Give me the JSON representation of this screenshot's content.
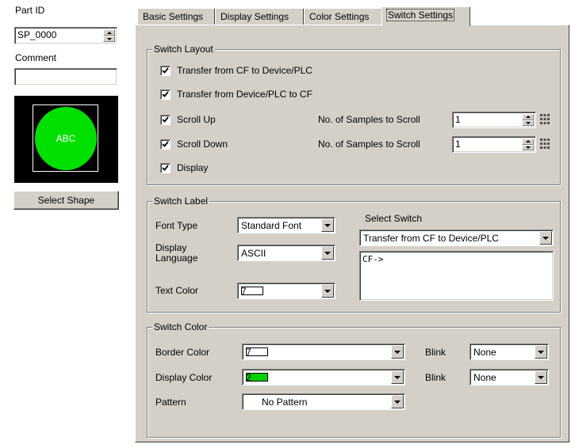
{
  "left": {
    "part_id_label": "Part ID",
    "part_id_value": "SP_0000",
    "comment_label": "Comment",
    "comment_value": "",
    "preview_text": "ABC",
    "select_shape_label": "Select Shape"
  },
  "tabs": [
    {
      "label": "Basic Settings"
    },
    {
      "label": "Display Settings"
    },
    {
      "label": "Color Settings"
    },
    {
      "label": "Switch Settings"
    }
  ],
  "switch_layout": {
    "title": "Switch Layout",
    "items": [
      {
        "label": "Transfer from CF to Device/PLC",
        "checked": true
      },
      {
        "label": "Transfer from Device/PLC to CF",
        "checked": true
      },
      {
        "label": "Scroll Up",
        "checked": true
      },
      {
        "label": "Scroll Down",
        "checked": true
      },
      {
        "label": "Display",
        "checked": true
      }
    ],
    "samples_label_1": "No. of Samples to Scroll",
    "samples_value_1": "1",
    "samples_label_2": "No. of Samples to Scroll",
    "samples_value_2": "1"
  },
  "switch_label": {
    "title": "Switch Label",
    "font_type_label": "Font Type",
    "font_type_value": "Standard Font",
    "display_language_label_1": "Display",
    "display_language_label_2": "Language",
    "display_language_value": "ASCII",
    "text_color_label": "Text Color",
    "text_color_value": "7",
    "select_switch_label": "Select Switch",
    "select_switch_value": "Transfer from CF to Device/PLC",
    "switch_text": "CF->"
  },
  "switch_color": {
    "title": "Switch Color",
    "border_color_label": "Border Color",
    "border_color_value": "7",
    "display_color_label": "Display Color",
    "display_color_value": "2",
    "pattern_label": "Pattern",
    "pattern_value": "No Pattern",
    "blink_label_1": "Blink",
    "blink_value_1": "None",
    "blink_label_2": "Blink",
    "blink_value_2": "None"
  },
  "colors": {
    "panel_bg": "#d4d0c8",
    "preview_bg": "#000000",
    "preview_circle": "#00e000",
    "display_swatch": "#00d000",
    "border_swatch": "#ffffff"
  }
}
